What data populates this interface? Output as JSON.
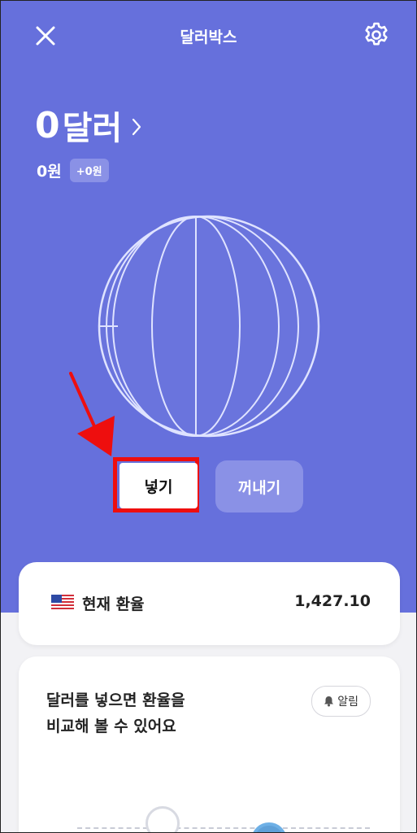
{
  "header": {
    "title": "달러박스"
  },
  "balance": {
    "amount": "0",
    "unit": "달러",
    "won": "0원",
    "won_change": "+0원"
  },
  "actions": {
    "put_label": "넣기",
    "take_label": "꺼내기"
  },
  "rate": {
    "label": "현재 환율",
    "value": "1,427.10"
  },
  "info": {
    "line1": "달러를 넣으면 환율을",
    "line2": "비교해 볼 수 있어요",
    "alarm_label": "알림"
  },
  "colors": {
    "hero_bg": "#6670dc",
    "accent_light": "#8a91e6",
    "highlight": "#ee0e0e"
  }
}
